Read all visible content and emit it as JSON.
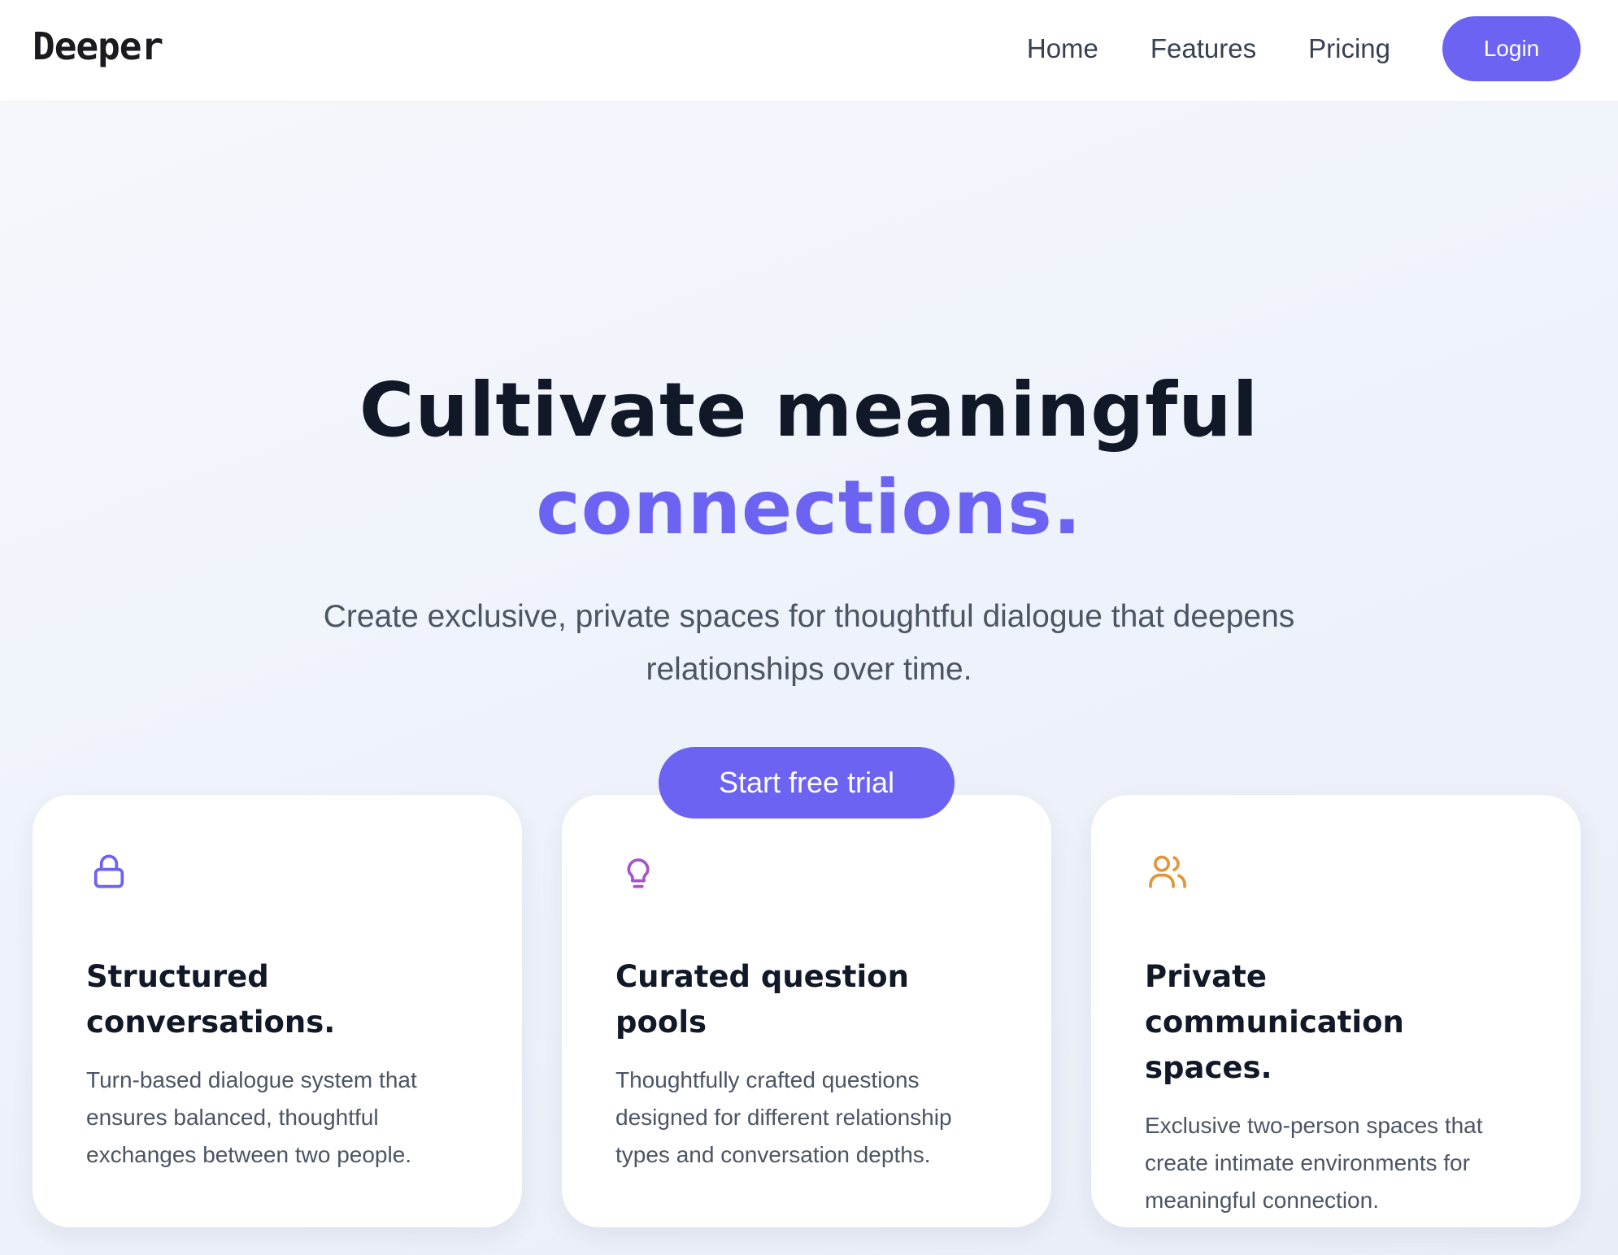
{
  "header": {
    "brand": "Deeper",
    "nav": [
      "Home",
      "Features",
      "Pricing"
    ],
    "login_label": "Login"
  },
  "hero": {
    "title_line1": "Cultivate meaningful",
    "title_line2": "connections.",
    "subtitle": "Create exclusive, private spaces for thoughtful dialogue that deepens relationships over time.",
    "cta_label": "Start free trial"
  },
  "features": [
    {
      "icon": "lock-icon",
      "icon_color": "#6c63f2",
      "title": "Structured conversations.",
      "description": "Turn-based dialogue system that ensures balanced, thoughtful exchanges between two people."
    },
    {
      "icon": "lightbulb-icon",
      "icon_color": "#a855c7",
      "title": "Curated question pools",
      "description": "Thoughtfully crafted questions designed for different relationship types and conversation depths."
    },
    {
      "icon": "users-icon",
      "icon_color": "#e0963a",
      "title": "Private communication spaces.",
      "description": "Exclusive two-person spaces that create intimate environments for meaningful connection."
    }
  ],
  "colors": {
    "accent": "#6c63f2",
    "heading": "#111827",
    "body_text": "#4b5563"
  }
}
